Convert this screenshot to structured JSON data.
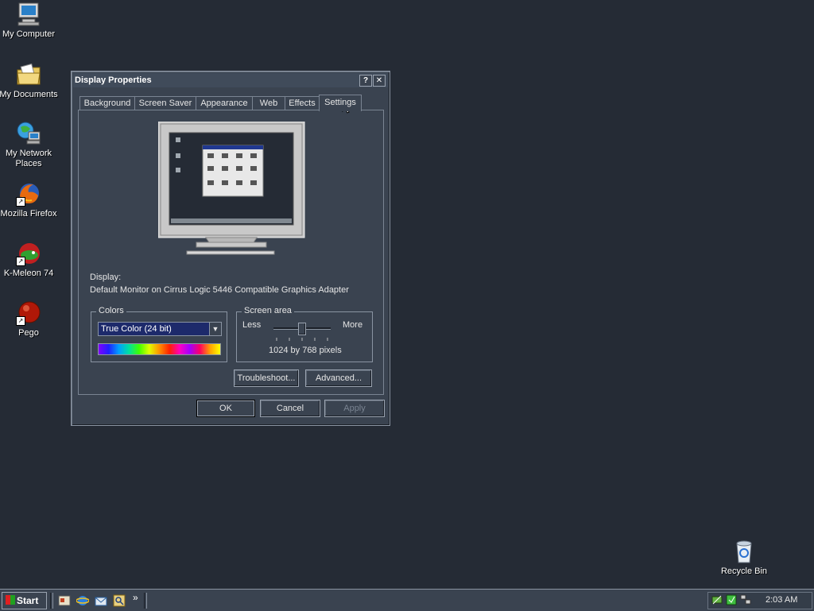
{
  "desktop": {
    "icons": [
      {
        "label": "My Computer"
      },
      {
        "label": "My Documents"
      },
      {
        "label": "My Network Places"
      },
      {
        "label": "Mozilla Firefox"
      },
      {
        "label": "K-Meleon 74"
      },
      {
        "label": "Pego"
      },
      {
        "label": "Recycle Bin"
      }
    ]
  },
  "window": {
    "title": "Display Properties",
    "help_btn": "?",
    "close_btn": "✕",
    "tabs": [
      "Background",
      "Screen Saver",
      "Appearance",
      "Web",
      "Effects",
      "Settings"
    ],
    "active_tab": "Settings",
    "display_label": "Display:",
    "display_value": "Default Monitor on Cirrus Logic 5446 Compatible Graphics Adapter",
    "colors_group": "Colors",
    "colors_selected": "True Color (24 bit)",
    "screen_area_group": "Screen area",
    "less_label": "Less",
    "more_label": "More",
    "resolution": "1024 by 768 pixels",
    "slider_position": 0.5,
    "troubleshoot_button": "Troubleshoot...",
    "advanced_button": "Advanced...",
    "ok_button": "OK",
    "cancel_button": "Cancel",
    "apply_button": "Apply"
  },
  "taskbar": {
    "start_label": "Start",
    "clock": "2:03 AM",
    "chevron": "»"
  },
  "colors": {
    "desktop_bg": "#252b35",
    "window_bg": "#3a4350",
    "select_bg": "#1d2a6b"
  }
}
